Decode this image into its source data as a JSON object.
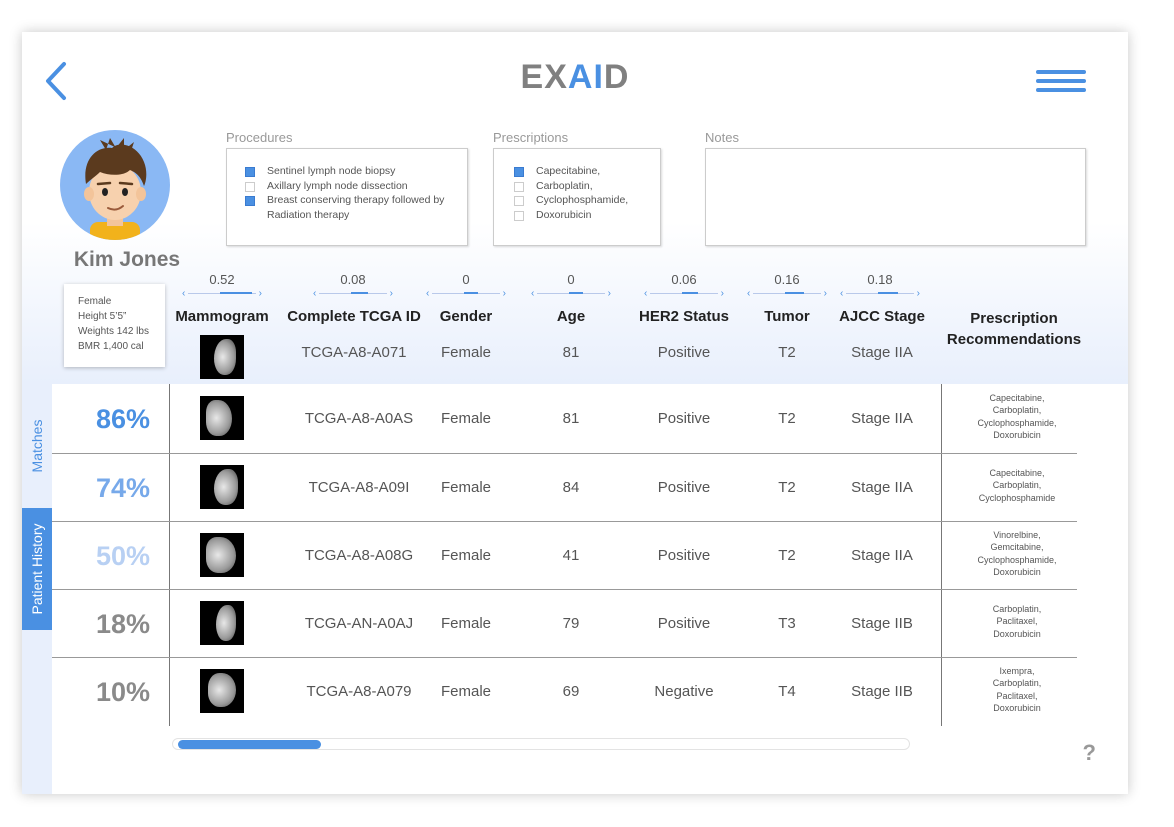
{
  "header": {
    "title_pre": "EX",
    "title_ai": "AI",
    "title_post": "D"
  },
  "patient": {
    "name": "Kim Jones",
    "details": [
      "Female",
      "Height 5’5”",
      "Weights 142 lbs",
      "BMR 1,400 cal"
    ]
  },
  "panels": {
    "procedures": {
      "label": "Procedures",
      "items": [
        {
          "text": "Sentinel lymph node biopsy",
          "checked": true
        },
        {
          "text": "Axillary lymph node dissection",
          "checked": false
        },
        {
          "text": "Breast conserving therapy followed by",
          "checked": true
        },
        {
          "text": "Radiation therapy",
          "checked": null
        }
      ]
    },
    "prescriptions": {
      "label": "Prescriptions",
      "items": [
        {
          "text": "Capecitabine,",
          "checked": true
        },
        {
          "text": "Carboplatin,",
          "checked": false
        },
        {
          "text": "Cyclophosphamide,",
          "checked": false
        },
        {
          "text": "Doxorubicin",
          "checked": false
        }
      ]
    },
    "notes": {
      "label": "Notes"
    }
  },
  "columns": [
    {
      "key": "mammogram",
      "label": "Mammogram",
      "weight": "0.52",
      "fill": 0.52
    },
    {
      "key": "tcga",
      "label": "Complete TCGA ID",
      "weight": "0.08",
      "fill": 0.08
    },
    {
      "key": "gender",
      "label": "Gender",
      "weight": "0",
      "fill": 0
    },
    {
      "key": "age",
      "label": "Age",
      "weight": "0",
      "fill": 0
    },
    {
      "key": "her2",
      "label": "HER2 Status",
      "weight": "0.06",
      "fill": 0.06
    },
    {
      "key": "tumor",
      "label": "Tumor",
      "weight": "0.16",
      "fill": 0.16
    },
    {
      "key": "ajcc",
      "label": "AJCC Stage",
      "weight": "0.18",
      "fill": 0.18
    },
    {
      "key": "rx",
      "label_1": "Prescription",
      "label_2": "Recommendations"
    }
  ],
  "query": {
    "tcga": "TCGA-A8-A071",
    "gender": "Female",
    "age": "81",
    "her2": "Positive",
    "tumor": "T2",
    "ajcc": "Stage IIA"
  },
  "tabs": {
    "matches": "Matches",
    "history": "Patient History"
  },
  "matches": [
    {
      "pct": "86%",
      "color": "#4a90e2",
      "tcga": "TCGA-A8-A0AS",
      "gender": "Female",
      "age": "81",
      "her2": "Positive",
      "tumor": "T2",
      "ajcc": "Stage IIA",
      "rx": [
        "Capecitabine,",
        "Carboplatin,",
        "Cyclophosphamide,",
        "Doxorubicin"
      ]
    },
    {
      "pct": "74%",
      "color": "#77a9ea",
      "tcga": "TCGA-A8-A09I",
      "gender": "Female",
      "age": "84",
      "her2": "Positive",
      "tumor": "T2",
      "ajcc": "Stage IIA",
      "rx": [
        "Capecitabine,",
        "Carboplatin,",
        "Cyclophosphamide"
      ]
    },
    {
      "pct": "50%",
      "color": "#b8d0f3",
      "tcga": "TCGA-A8-A08G",
      "gender": "Female",
      "age": "41",
      "her2": "Positive",
      "tumor": "T2",
      "ajcc": "Stage IIA",
      "rx": [
        "Vinorelbine,",
        "Gemcitabine,",
        "Cyclophosphamide,",
        "Doxorubicin"
      ]
    },
    {
      "pct": "18%",
      "color": "#8a8a8a",
      "tcga": "TCGA-AN-A0AJ",
      "gender": "Female",
      "age": "79",
      "her2": "Positive",
      "tumor": "T3",
      "ajcc": "Stage IIB",
      "rx": [
        "Carboplatin,",
        "Paclitaxel,",
        "Doxorubicin"
      ]
    },
    {
      "pct": "10%",
      "color": "#8a8a8a",
      "tcga": "TCGA-A8-A079",
      "gender": "Female",
      "age": "69",
      "her2": "Negative",
      "tumor": "T4",
      "ajcc": "Stage IIB",
      "rx": [
        "Ixempra,",
        "Carboplatin,",
        "Paclitaxel,",
        "Doxorubicin"
      ]
    }
  ],
  "help": "?"
}
